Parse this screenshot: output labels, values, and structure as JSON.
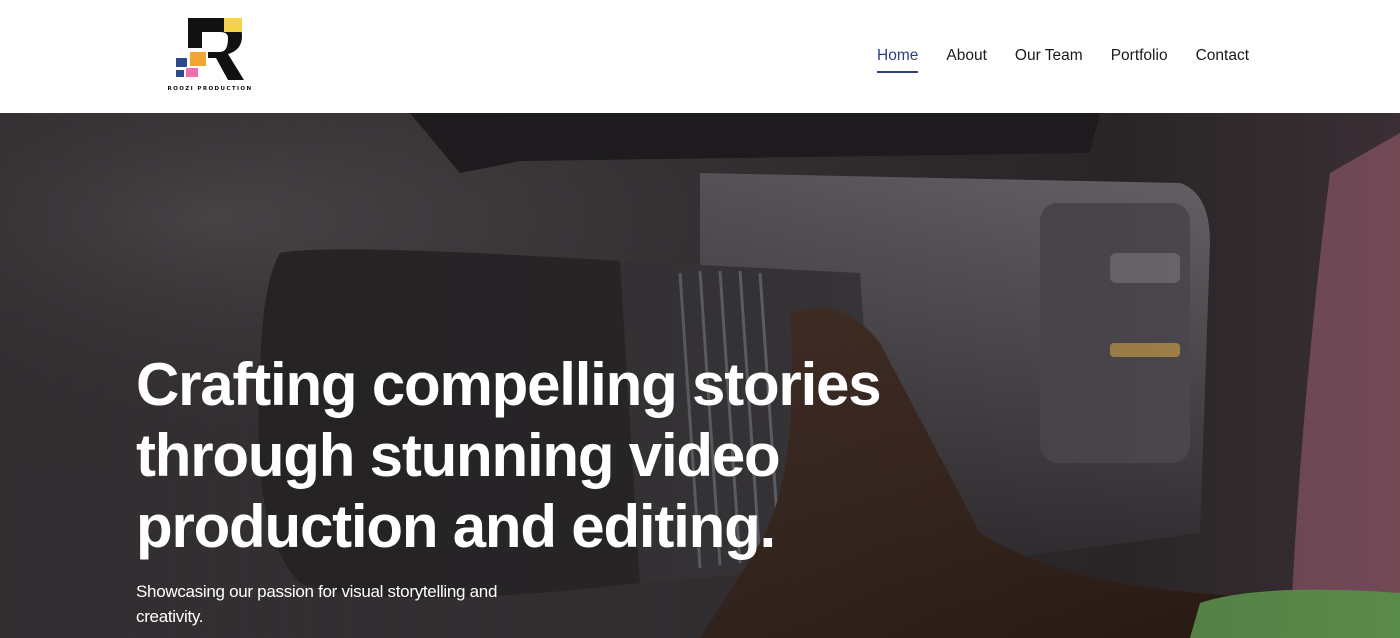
{
  "brand": {
    "name": "ROOZI PRODUCTION",
    "colors": {
      "yellow": "#f4d34a",
      "orange": "#f2a533",
      "pink": "#f06fb0",
      "blue": "#2f4a8c",
      "black": "#111111"
    }
  },
  "nav": {
    "items": [
      {
        "label": "Home",
        "active": true
      },
      {
        "label": "About",
        "active": false
      },
      {
        "label": "Our Team",
        "active": false
      },
      {
        "label": "Portfolio",
        "active": false
      },
      {
        "label": "Contact",
        "active": false
      }
    ],
    "active_color": "#2f3f86"
  },
  "hero": {
    "title_lines": [
      "Crafting compelling stories",
      "through stunning video",
      "production and editing."
    ],
    "subtitle_lines": [
      "Showcasing our passion for visual storytelling and",
      "creativity."
    ],
    "background_image": "camera-operator-photo"
  }
}
